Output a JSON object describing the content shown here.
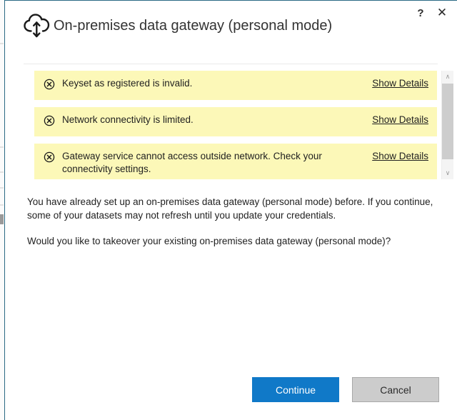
{
  "window": {
    "title": "On-premises data gateway (personal mode)",
    "brand_icon": "cloud-upload-download-icon",
    "help_label": "?",
    "close_label": "✕",
    "accent_color": "#1079c8",
    "border_color": "#2a6a84"
  },
  "notifications": {
    "warning_bg": "#fcf8b8",
    "items": [
      {
        "icon": "error-circle-x-icon",
        "message": "Keyset as registered is invalid.",
        "link_label": "Show Details"
      },
      {
        "icon": "error-circle-x-icon",
        "message": "Network connectivity is limited.",
        "link_label": "Show Details"
      },
      {
        "icon": "error-circle-x-icon",
        "message": "Gateway service cannot access outside network. Check your connectivity settings.",
        "link_label": "Show Details"
      }
    ],
    "scrollbar": {
      "up_arrow": "∧",
      "down_arrow": "∨"
    }
  },
  "body": {
    "paragraphs": [
      "You have already set up an on-premises data gateway (personal mode) before. If you continue, some of your datasets may not refresh until you update your credentials.",
      "Would you like to takeover your existing on-premises data gateway (personal mode)?"
    ]
  },
  "footer": {
    "continue_label": "Continue",
    "cancel_label": "Cancel"
  }
}
